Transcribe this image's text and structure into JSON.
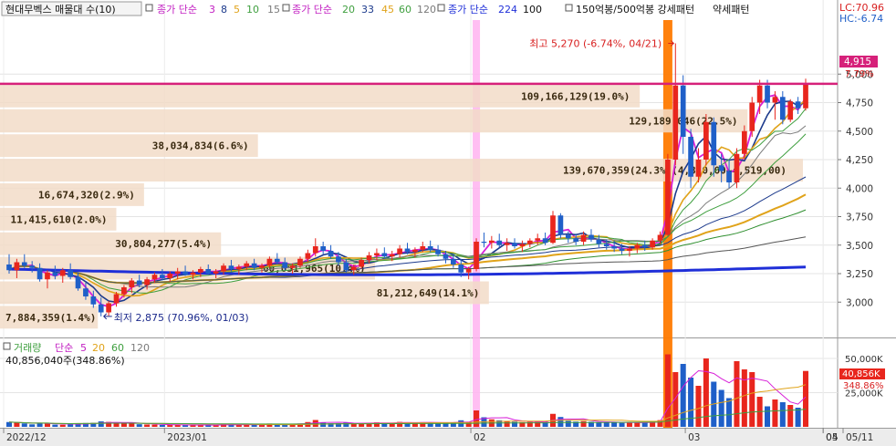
{
  "header": {
    "title": "현대무벡스 매물대 수(10)",
    "ma_price_1_label": "종가 단순",
    "ma_price_1_periods": [
      "3",
      "8",
      "5",
      "10",
      "15"
    ],
    "ma_price_2_label": "종가 단순",
    "ma_price_2_periods": [
      "20",
      "33",
      "45",
      "60",
      "120"
    ],
    "ma_price_3_label": "종가 단순",
    "ma_price_3_periods": [
      "224",
      "100"
    ],
    "pattern_label": "150억봉/500억봉 강세패턴",
    "pattern_label_2": "약세패턴",
    "lc_label": "LC:70.96",
    "hc_label": "HC:-6.74"
  },
  "annotations": {
    "high_label": "최고 5,270 (-6.74%, 04/21)",
    "low_label": "최저 2,875 (70.96%, 01/03)",
    "current_price": "4,915",
    "current_pct": "7.79%"
  },
  "volume_header": {
    "label": "거래량",
    "ma_label": "단순",
    "periods": [
      "5",
      "20",
      "60",
      "120"
    ],
    "summary": "40,856,040주(348.86%)",
    "current_value": "40,856K",
    "current_pct": "348.86%"
  },
  "colors": {
    "up": "#e8261d",
    "down": "#1f5fc8",
    "ma3": "#d81fd8",
    "ma5": "#1c3a8c",
    "ma10": "#3f9f3f",
    "ma15": "#7a7a7a",
    "ma20": "#e0a31a",
    "ma224": "#1f2fd8",
    "resistance": "#d6217a",
    "profile": "#f2dcc8",
    "pattern_strong": "#ff7a00",
    "pattern_weak": "#ffb3f0"
  },
  "chart_data": {
    "type": "candlestick",
    "title": "현대무벡스 매물대 수(10)",
    "yaxis_ticks": [
      "5,000",
      "4,750",
      "4,500",
      "4,250",
      "4,000",
      "3,750",
      "3,500",
      "3,250",
      "3,000"
    ],
    "yaxis_values": [
      5000,
      4750,
      4500,
      4250,
      4000,
      3750,
      3500,
      3250,
      3000
    ],
    "ylim": [
      2770,
      5410
    ],
    "xaxis_labels": [
      "2022/12",
      "2023/01",
      "02",
      "03",
      "04",
      "05",
      "05/11"
    ],
    "volume_ticks": [
      "50,000K",
      "25,000K"
    ],
    "volume_values": [
      50000,
      25000
    ],
    "volume_ylim": [
      0,
      60000
    ],
    "resistance_price": 4915,
    "volume_profile": [
      {
        "label": "109,166,129(19.0%)",
        "price_low": 4700,
        "price_high": 4915,
        "pct": 19.0
      },
      {
        "label": "129,189,046(22.5%)",
        "price_low": 4480,
        "price_high": 4700,
        "pct": 22.5
      },
      {
        "label": "38,034,834(6.6%)",
        "price_low": 4265,
        "price_high": 4480,
        "pct": 6.6
      },
      {
        "label": "139,670,359(24.3%)(4,3,0,00~4,519,00)",
        "price_low": 4050,
        "price_high": 4265,
        "pct": 24.3
      },
      {
        "label": "16,674,320(2.9%)",
        "price_low": 3835,
        "price_high": 4050,
        "pct": 2.9
      },
      {
        "label": "11,415,610(2.0%)",
        "price_low": 3620,
        "price_high": 3835,
        "pct": 2.0
      },
      {
        "label": "30,804,277(5.4%)",
        "price_low": 3405,
        "price_high": 3620,
        "pct": 5.4
      },
      {
        "label": "60,051,965(10.4%)",
        "price_low": 3190,
        "price_high": 3405,
        "pct": 10.4
      },
      {
        "label": "81,212,649(14.1%)",
        "price_low": 2975,
        "price_high": 3190,
        "pct": 14.1
      },
      {
        "label": "7,884,359(1.4%)",
        "price_low": 2760,
        "price_high": 2975,
        "pct": 1.4
      }
    ],
    "candles": [
      [
        3330,
        3420,
        3250,
        3280,
        3500
      ],
      [
        3280,
        3380,
        3210,
        3350,
        3000
      ],
      [
        3350,
        3420,
        3300,
        3320,
        2500
      ],
      [
        3320,
        3360,
        3260,
        3300,
        1800
      ],
      [
        3300,
        3340,
        3180,
        3200,
        2800
      ],
      [
        3200,
        3280,
        3120,
        3260,
        2600
      ],
      [
        3260,
        3320,
        3200,
        3230,
        1600
      ],
      [
        3230,
        3300,
        3170,
        3280,
        1500
      ],
      [
        3280,
        3340,
        3200,
        3220,
        1900
      ],
      [
        3220,
        3260,
        3100,
        3120,
        2500
      ],
      [
        3120,
        3170,
        3020,
        3050,
        2800
      ],
      [
        3050,
        3100,
        2950,
        2980,
        3000
      ],
      [
        2980,
        3040,
        2875,
        2910,
        4000
      ],
      [
        2910,
        3010,
        2880,
        2990,
        3600
      ],
      [
        2990,
        3090,
        2960,
        3070,
        2900
      ],
      [
        3070,
        3150,
        3040,
        3130,
        2600
      ],
      [
        3130,
        3210,
        3080,
        3190,
        2500
      ],
      [
        3190,
        3240,
        3130,
        3150,
        1900
      ],
      [
        3150,
        3220,
        3110,
        3200,
        1700
      ],
      [
        3200,
        3260,
        3170,
        3240,
        1600
      ],
      [
        3240,
        3290,
        3190,
        3210,
        1400
      ],
      [
        3210,
        3270,
        3180,
        3250,
        1300
      ],
      [
        3250,
        3300,
        3200,
        3270,
        1500
      ],
      [
        3270,
        3320,
        3230,
        3240,
        1300
      ],
      [
        3240,
        3280,
        3200,
        3260,
        1200
      ],
      [
        3260,
        3310,
        3220,
        3290,
        1400
      ],
      [
        3290,
        3330,
        3240,
        3250,
        1300
      ],
      [
        3250,
        3290,
        3210,
        3270,
        1200
      ],
      [
        3270,
        3340,
        3240,
        3320,
        2000
      ],
      [
        3320,
        3370,
        3270,
        3290,
        1800
      ],
      [
        3290,
        3330,
        3240,
        3310,
        1500
      ],
      [
        3310,
        3360,
        3280,
        3340,
        1600
      ],
      [
        3340,
        3380,
        3280,
        3300,
        1500
      ],
      [
        3300,
        3340,
        3260,
        3320,
        1400
      ],
      [
        3320,
        3400,
        3300,
        3380,
        2400
      ],
      [
        3380,
        3430,
        3330,
        3350,
        2300
      ],
      [
        3350,
        3390,
        3280,
        3300,
        2100
      ],
      [
        3300,
        3340,
        3250,
        3320,
        1800
      ],
      [
        3320,
        3400,
        3300,
        3380,
        2400
      ],
      [
        3380,
        3460,
        3350,
        3430,
        3500
      ],
      [
        3430,
        3560,
        3400,
        3490,
        5000
      ],
      [
        3490,
        3530,
        3420,
        3450,
        3000
      ],
      [
        3450,
        3500,
        3380,
        3400,
        2600
      ],
      [
        3400,
        3440,
        3320,
        3350,
        2700
      ],
      [
        3350,
        3380,
        3260,
        3280,
        3200
      ],
      [
        3280,
        3330,
        3240,
        3310,
        2200
      ],
      [
        3310,
        3390,
        3290,
        3370,
        2600
      ],
      [
        3370,
        3440,
        3340,
        3410,
        3000
      ],
      [
        3410,
        3470,
        3370,
        3430,
        3300
      ],
      [
        3430,
        3480,
        3380,
        3400,
        2800
      ],
      [
        3400,
        3450,
        3360,
        3420,
        2600
      ],
      [
        3420,
        3500,
        3390,
        3470,
        3600
      ],
      [
        3470,
        3520,
        3420,
        3440,
        3300
      ],
      [
        3440,
        3480,
        3390,
        3460,
        2900
      ],
      [
        3460,
        3530,
        3440,
        3490,
        3400
      ],
      [
        3490,
        3540,
        3440,
        3460,
        3100
      ],
      [
        3460,
        3500,
        3400,
        3420,
        2900
      ],
      [
        3420,
        3450,
        3340,
        3380,
        3200
      ],
      [
        3380,
        3420,
        3300,
        3330,
        3000
      ],
      [
        3330,
        3380,
        3220,
        3260,
        4800
      ],
      [
        3260,
        3310,
        3200,
        3290,
        3600
      ],
      [
        3290,
        3560,
        3270,
        3530,
        12000
      ],
      [
        3530,
        3610,
        3480,
        3520,
        7000
      ],
      [
        3520,
        3580,
        3470,
        3540,
        5500
      ],
      [
        3540,
        3600,
        3480,
        3500,
        4800
      ],
      [
        3500,
        3560,
        3450,
        3520,
        4200
      ],
      [
        3520,
        3560,
        3470,
        3490,
        3700
      ],
      [
        3490,
        3540,
        3440,
        3510,
        3400
      ],
      [
        3510,
        3560,
        3480,
        3540,
        3600
      ],
      [
        3540,
        3600,
        3500,
        3560,
        3800
      ],
      [
        3560,
        3610,
        3500,
        3520,
        3500
      ],
      [
        3520,
        3800,
        3510,
        3760,
        9500
      ],
      [
        3760,
        3780,
        3560,
        3590,
        7200
      ],
      [
        3590,
        3620,
        3520,
        3560,
        4400
      ],
      [
        3560,
        3600,
        3500,
        3530,
        3800
      ],
      [
        3530,
        3620,
        3500,
        3590,
        4200
      ],
      [
        3590,
        3640,
        3530,
        3550,
        3700
      ],
      [
        3550,
        3590,
        3480,
        3510,
        3400
      ],
      [
        3510,
        3550,
        3460,
        3490,
        3200
      ],
      [
        3490,
        3540,
        3440,
        3470,
        3000
      ],
      [
        3470,
        3510,
        3420,
        3450,
        2900
      ],
      [
        3450,
        3490,
        3400,
        3470,
        3100
      ],
      [
        3470,
        3520,
        3430,
        3500,
        3300
      ],
      [
        3500,
        3540,
        3450,
        3480,
        3100
      ],
      [
        3480,
        3560,
        3460,
        3540,
        3800
      ],
      [
        3540,
        3620,
        3510,
        3590,
        4900
      ],
      [
        3590,
        4300,
        3580,
        4250,
        53000
      ],
      [
        4250,
        5270,
        4200,
        4900,
        40000
      ],
      [
        4900,
        4990,
        4300,
        4450,
        46000
      ],
      [
        4450,
        4520,
        4000,
        4100,
        36000
      ],
      [
        4100,
        4350,
        4050,
        4250,
        30000
      ],
      [
        4250,
        4650,
        4200,
        4580,
        50000
      ],
      [
        4580,
        4620,
        4100,
        4200,
        33000
      ],
      [
        4200,
        4300,
        4050,
        4150,
        27000
      ],
      [
        4150,
        4250,
        4000,
        4050,
        21000
      ],
      [
        4050,
        4350,
        4000,
        4300,
        48000
      ],
      [
        4300,
        4550,
        4250,
        4500,
        42000
      ],
      [
        4500,
        4800,
        4450,
        4750,
        40000
      ],
      [
        4750,
        4950,
        4650,
        4900,
        22000
      ],
      [
        4900,
        4950,
        4700,
        4750,
        15000
      ],
      [
        4750,
        4850,
        4600,
        4800,
        20000
      ],
      [
        4800,
        4850,
        4560,
        4600,
        18000
      ],
      [
        4600,
        4780,
        4580,
        4760,
        16000
      ],
      [
        4760,
        4800,
        4650,
        4700,
        14000
      ],
      [
        4700,
        4960,
        4680,
        4915,
        40856
      ]
    ]
  }
}
